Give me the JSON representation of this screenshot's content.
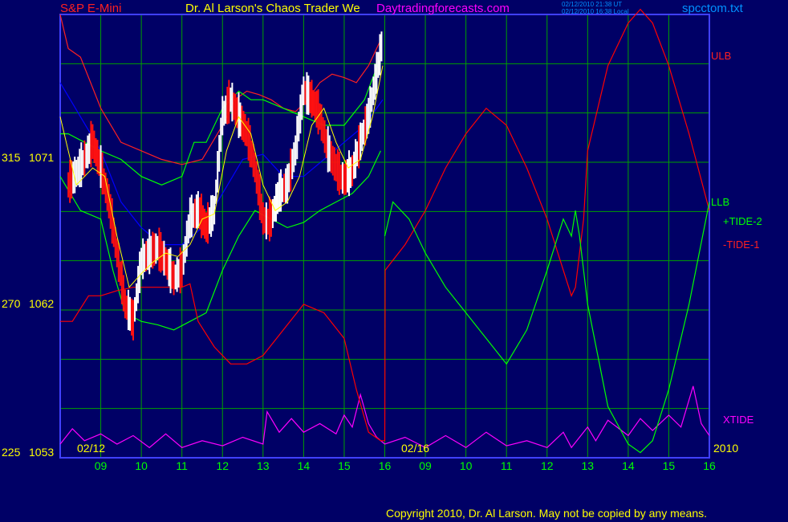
{
  "header": {
    "symbol": "S&P E-Mini",
    "title": "Dr. Al Larson's Chaos Trader We",
    "site": "Daytradingforecasts.com",
    "stamp_line1": "02/12/2010 21:38 UT",
    "stamp_line2": "02/12/2010 16:38 Local",
    "filename": "spcctom.txt"
  },
  "footer": {
    "copyright": "Copyright 2010, Dr. Al Larson. May not be copied by any means."
  },
  "colors": {
    "background": "#000066",
    "grid": "#00a000",
    "frame": "#4040ff",
    "symbol": "#ff2020",
    "title": "#ffff00",
    "site": "#ff00ff",
    "file": "#0090ff",
    "price_up": "#ffffff",
    "price_down": "#ff1010",
    "ma": "#ffff00",
    "ma2": "#0000ff",
    "ulb": "#ff2020",
    "llb": "#00ff00",
    "tide2": "#00ff00",
    "tide1": "#ff0000",
    "xtide": "#ff00ff"
  },
  "chart_data": {
    "type": "line",
    "title": "S&P E-Mini",
    "x_tick_labels": [
      "09",
      "10",
      "11",
      "12",
      "13",
      "14",
      "15",
      "16",
      "09",
      "10",
      "11",
      "12",
      "13",
      "14",
      "15",
      "16"
    ],
    "date_labels": [
      "02/12",
      "02/16"
    ],
    "year_label": "2010",
    "y_ticks": [
      {
        "left": "315",
        "right": "1071",
        "price": 1071
      },
      {
        "left": "270",
        "right": "1062",
        "price": 1062
      },
      {
        "left": "225",
        "right": "1053",
        "price": 1053
      }
    ],
    "ylim": [
      1053,
      1079
    ],
    "grid": true,
    "series_labels": {
      "ulb": "ULB",
      "llb": "LLB",
      "tide2": "+TIDE-2",
      "tide1": "-TIDE-1",
      "xtide": "XTIDE"
    },
    "price": {
      "x": [
        8.2,
        8.5,
        8.8,
        9.0,
        9.2,
        9.4,
        9.6,
        9.8,
        10.0,
        10.2,
        10.4,
        10.6,
        10.8,
        11.0,
        11.2,
        11.4,
        11.6,
        11.8,
        12.0,
        12.2,
        12.4,
        12.6,
        12.8,
        13.0,
        13.1,
        13.2,
        13.4,
        13.6,
        13.8,
        14.0,
        14.2,
        14.4,
        14.6,
        14.8,
        14.9,
        15.0,
        15.2,
        15.4,
        15.6,
        15.8,
        15.95
      ],
      "y": [
        1069,
        1070,
        1071.5,
        1070,
        1068,
        1065,
        1062,
        1061,
        1064.5,
        1065,
        1065.3,
        1064.5,
        1063.5,
        1064,
        1067,
        1067.5,
        1066.5,
        1067.5,
        1073,
        1074,
        1073,
        1072,
        1070,
        1067,
        1066.8,
        1067,
        1068.5,
        1069,
        1071,
        1074.5,
        1074,
        1073,
        1071,
        1070,
        1069.5,
        1069.3,
        1069.8,
        1071.5,
        1073,
        1075.5,
        1077.5
      ]
    },
    "ma": {
      "x": [
        8.0,
        8.4,
        8.8,
        9.1,
        9.4,
        9.7,
        10.0,
        10.3,
        10.6,
        10.9,
        11.2,
        11.5,
        11.8,
        12.1,
        12.4,
        12.7,
        13.0,
        13.3,
        13.6,
        13.9,
        14.2,
        14.5,
        14.8,
        15.1,
        15.4,
        15.7,
        15.95
      ],
      "y": [
        1073,
        1069,
        1070,
        1069.5,
        1066,
        1063,
        1063.8,
        1064.5,
        1065,
        1064.8,
        1065.5,
        1067,
        1067.3,
        1071,
        1073,
        1072,
        1069,
        1067.5,
        1068,
        1069.5,
        1072.5,
        1073.5,
        1071.5,
        1070,
        1070.5,
        1073,
        1076
      ]
    },
    "ma2": {
      "x": [
        8.0,
        8.5,
        9.0,
        9.5,
        10.0,
        10.5,
        11.0,
        11.5,
        12.0,
        12.5,
        13.0,
        13.5,
        14.0,
        14.5,
        15.0,
        15.5,
        15.95
      ],
      "y": [
        1075,
        1073,
        1071,
        1068,
        1066.5,
        1065.5,
        1065.5,
        1066.5,
        1068.5,
        1070.5,
        1070.8,
        1069.5,
        1069.5,
        1070.5,
        1071.5,
        1072.5,
        1074
      ]
    },
    "ulb": {
      "x": [
        8.0,
        8.2,
        8.5,
        9.0,
        9.5,
        10.0,
        10.5,
        11.0,
        11.5,
        12.0,
        12.3,
        12.6,
        12.9,
        13.2,
        13.5,
        13.8,
        14.1,
        14.4,
        14.7,
        15.0,
        15.3,
        15.6,
        15.9
      ],
      "y": [
        1079,
        1077,
        1076.5,
        1073.5,
        1071.5,
        1071,
        1070.5,
        1070.2,
        1070.5,
        1072.5,
        1074,
        1074.5,
        1074.3,
        1074,
        1073.5,
        1073.3,
        1074,
        1075,
        1075.5,
        1075.3,
        1075,
        1076,
        1077.5
      ]
    },
    "llb": {
      "x": [
        8.0,
        8.5,
        9.0,
        9.3,
        9.6,
        10.0,
        10.4,
        10.8,
        11.2,
        11.6,
        12.0,
        12.4,
        12.8,
        13.2,
        13.6,
        14.0,
        14.4,
        14.8,
        15.2,
        15.6,
        15.9
      ],
      "y": [
        1069.5,
        1067.5,
        1067,
        1064,
        1061.5,
        1061,
        1060.8,
        1060.5,
        1061,
        1061.5,
        1064,
        1066,
        1067.5,
        1067,
        1066.5,
        1066.8,
        1067.5,
        1068,
        1068.5,
        1069.5,
        1071
      ]
    },
    "green_env": {
      "x": [
        8.0,
        8.2,
        8.6,
        9.0,
        9.5,
        10.0,
        10.5,
        11.0,
        11.3,
        11.6,
        12.0,
        12.4,
        12.7,
        13.0,
        13.5,
        14.0,
        14.5,
        15.0,
        15.5,
        15.9
      ],
      "y": [
        1072,
        1072,
        1071.5,
        1071,
        1070.5,
        1069.5,
        1069,
        1069.5,
        1071.5,
        1071.5,
        1073.5,
        1074.5,
        1074,
        1074,
        1073.5,
        1073,
        1072.5,
        1072.5,
        1074,
        1076.5
      ]
    },
    "tide1": {
      "x": [
        8.0,
        8.3,
        8.7,
        9.0,
        9.4,
        9.8,
        10.2,
        10.6,
        11.0,
        11.2,
        11.4,
        11.8,
        12.2,
        12.6,
        13.0,
        13.5,
        14.0,
        14.5,
        15.0,
        15.3,
        15.6,
        15.9,
        16.0,
        16.01,
        16.5,
        17.0,
        17.5,
        18.0,
        18.5,
        19.0,
        19.5,
        20.0,
        20.6,
        20.7,
        20.8,
        20.9,
        21.0,
        21.5,
        22.0,
        22.3,
        22.6,
        23.0,
        23.5,
        24.0
      ],
      "y": [
        1061,
        1061,
        1062.5,
        1062.5,
        1062.8,
        1063,
        1063,
        1063,
        1063,
        1063.2,
        1061,
        1059.5,
        1058.5,
        1058.5,
        1059,
        1060.5,
        1062,
        1061.5,
        1060,
        1057,
        1054.5,
        1054,
        1054,
        1064,
        1065.5,
        1067.5,
        1070,
        1072,
        1073.5,
        1072.5,
        1070,
        1067,
        1062.5,
        1063,
        1065,
        1067,
        1071,
        1076,
        1078.5,
        1079.3,
        1078.5,
        1076,
        1072,
        1067.5
      ]
    },
    "tide2": {
      "x": [
        16.0,
        16.2,
        16.6,
        17.0,
        17.5,
        18.0,
        18.5,
        19.0,
        19.5,
        20.0,
        20.4,
        20.6,
        20.7,
        20.8,
        21.0,
        21.5,
        22.0,
        22.3,
        22.6,
        23.0,
        23.5,
        24.0
      ],
      "y": [
        1066,
        1068,
        1067,
        1065,
        1063,
        1061.5,
        1060,
        1058.5,
        1060.5,
        1064,
        1067,
        1066,
        1067.5,
        1066,
        1062,
        1056,
        1053.8,
        1053.3,
        1054,
        1057,
        1062,
        1068
      ]
    },
    "xtide": {
      "x": [
        8.0,
        8.3,
        8.6,
        9.0,
        9.4,
        9.8,
        10.2,
        10.6,
        11.0,
        11.5,
        12.0,
        12.5,
        13.0,
        13.1,
        13.4,
        13.7,
        14.0,
        14.4,
        14.8,
        15.0,
        15.2,
        15.4,
        15.6,
        15.8,
        16.0,
        16.5,
        17.0,
        17.5,
        18.0,
        18.5,
        19.0,
        19.5,
        20.0,
        20.4,
        20.6,
        20.8,
        21.0,
        21.2,
        21.5,
        22.0,
        22.3,
        22.6,
        23.0,
        23.3,
        23.6,
        23.8,
        24.0
      ],
      "y": [
        1053.8,
        1054.7,
        1054,
        1054.4,
        1053.8,
        1054.3,
        1053.6,
        1054.4,
        1053.6,
        1054,
        1053.7,
        1054.2,
        1053.8,
        1055.7,
        1054.5,
        1055.3,
        1054.5,
        1055,
        1054.4,
        1055.5,
        1054.8,
        1056.7,
        1055,
        1054.2,
        1053.8,
        1054.2,
        1053.6,
        1054.3,
        1053.6,
        1054.5,
        1053.7,
        1054,
        1053.6,
        1054.5,
        1053.6,
        1054.2,
        1054.8,
        1054,
        1055.2,
        1054.3,
        1055.3,
        1054.6,
        1055.5,
        1054.8,
        1057.2,
        1055,
        1054.3
      ]
    }
  }
}
